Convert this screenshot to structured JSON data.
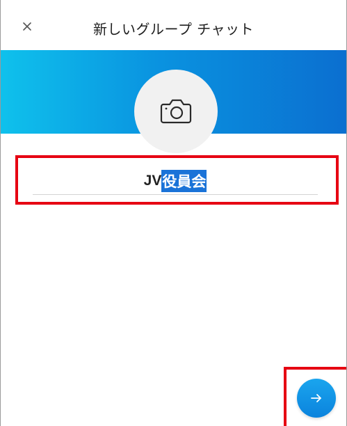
{
  "header": {
    "title": "新しいグループ チャット",
    "close_icon": "close-icon"
  },
  "banner": {
    "gradient_start": "#0fc1ec",
    "gradient_end": "#0b6fd0"
  },
  "avatar": {
    "icon": "camera-icon"
  },
  "group_name": {
    "prefix": "JV",
    "selected": "役員会",
    "selection_color": "#1a73d8"
  },
  "next_button": {
    "icon": "arrow-right-icon",
    "color": "#0b83dd"
  },
  "annotations": {
    "highlight_color": "#e60012"
  }
}
